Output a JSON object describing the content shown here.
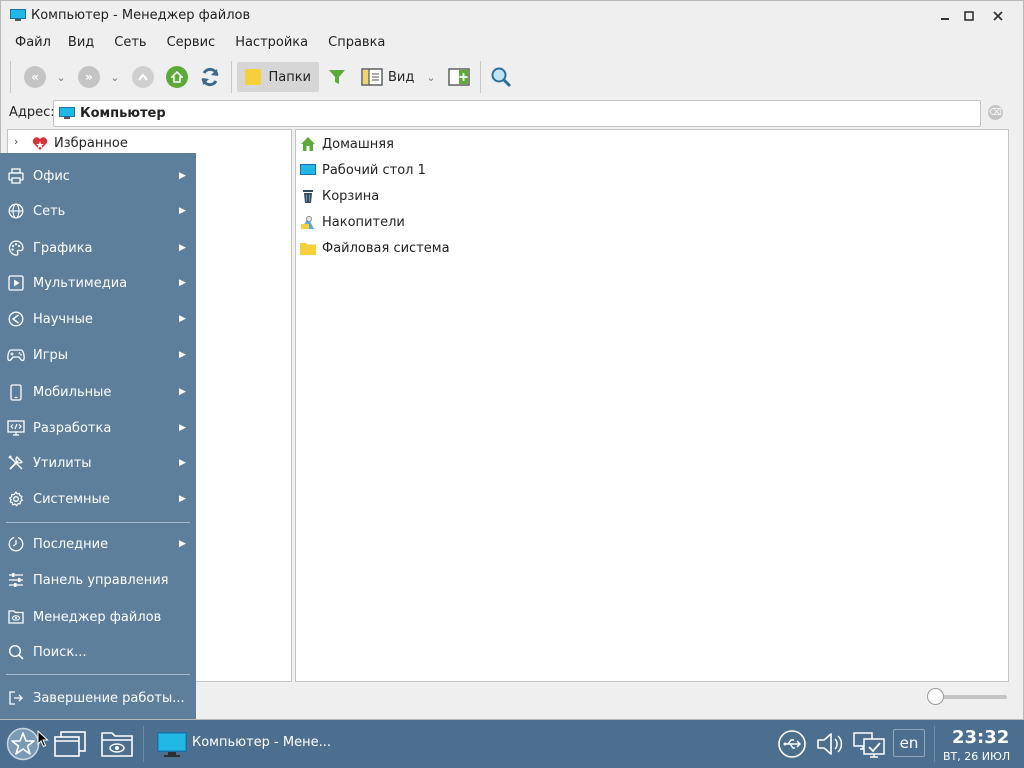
{
  "window": {
    "title": "Компьютер - Менеджер файлов",
    "controls": [
      "minimize",
      "maximize",
      "close"
    ]
  },
  "menubar": [
    "Файл",
    "Вид",
    "Сеть",
    "Сервис",
    "Настройка",
    "Справка"
  ],
  "toolbar": {
    "folders_label": "Папки",
    "view_label": "Вид"
  },
  "address": {
    "label": "Адрес:",
    "value": "Компьютер"
  },
  "tree": {
    "favorites_label": "Избранное"
  },
  "list": {
    "items": [
      {
        "label": "Домашняя",
        "icon": "home-icon"
      },
      {
        "label": "Рабочий стол 1",
        "icon": "desktop-icon"
      },
      {
        "label": "Корзина",
        "icon": "trash-icon"
      },
      {
        "label": "Накопители",
        "icon": "drives-icon"
      },
      {
        "label": "Файловая система",
        "icon": "folder-icon"
      }
    ]
  },
  "start_menu": {
    "categories": [
      {
        "label": "Офис",
        "icon": "printer-icon"
      },
      {
        "label": "Сеть",
        "icon": "globe-icon"
      },
      {
        "label": "Графика",
        "icon": "palette-icon"
      },
      {
        "label": "Мультимедиа",
        "icon": "play-icon"
      },
      {
        "label": "Научные",
        "icon": "science-icon"
      },
      {
        "label": "Игры",
        "icon": "gamepad-icon"
      },
      {
        "label": "Мобильные",
        "icon": "phone-icon"
      },
      {
        "label": "Разработка",
        "icon": "code-icon"
      },
      {
        "label": "Утилиты",
        "icon": "tools-icon"
      },
      {
        "label": "Системные",
        "icon": "gear-icon"
      }
    ],
    "recent_label": "Последние",
    "actions": [
      {
        "label": "Панель управления",
        "icon": "sliders-icon"
      },
      {
        "label": "Менеджер файлов",
        "icon": "file-manager-icon"
      },
      {
        "label": "Поиск...",
        "icon": "search-icon"
      }
    ],
    "shutdown_label": "Завершение работы..."
  },
  "taskbar": {
    "task_title": "Компьютер - Мене...",
    "lang": "en",
    "time": "23:32",
    "date": "ВТ, 26 ИЮЛ"
  },
  "colors": {
    "menu_bg": "#5e7f9c",
    "taskbar_bg": "#4d6f8f",
    "accent_green": "#5daa3b",
    "folder_yellow": "#f6cf3c"
  }
}
